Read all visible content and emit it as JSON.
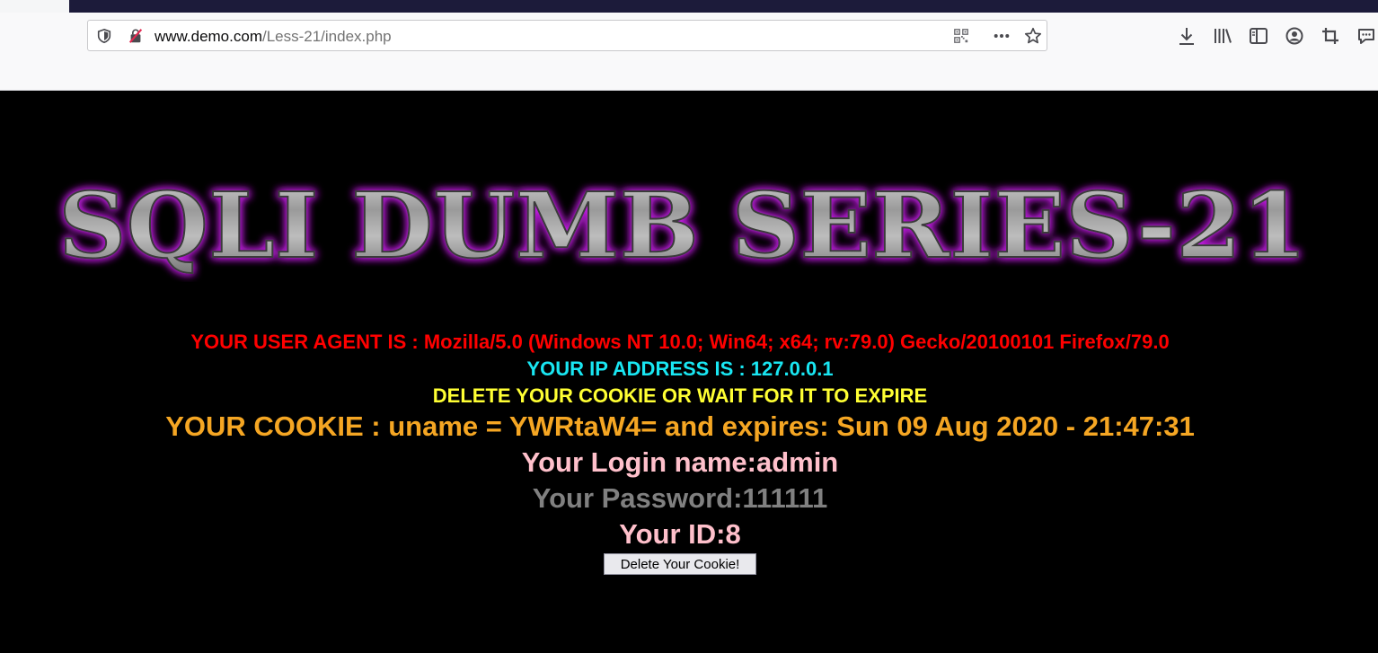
{
  "browser": {
    "url_host": "www.demo.com",
    "url_path": "/Less-21/index.php",
    "icons": [
      "shield-icon",
      "insecure-lock-icon",
      "qr-code-icon",
      "more-icon",
      "star-icon",
      "download-icon",
      "library-icon",
      "sidebar-icon",
      "account-icon",
      "screenshot-icon",
      "chat-icon"
    ]
  },
  "page": {
    "banner_text": "SQLI DUMB SERIES-21",
    "user_agent_line": "YOUR USER AGENT IS : Mozilla/5.0 (Windows NT 10.0; Win64; x64; rv:79.0) Gecko/20100101 Firefox/79.0",
    "ip_line": "YOUR IP ADDRESS IS : 127.0.0.1",
    "delete_notice": "DELETE YOUR COOKIE OR WAIT FOR IT TO EXPIRE",
    "cookie_line": "YOUR COOKIE : uname = YWRtaW4= and expires: Sun 09 Aug 2020 - 21:47:31",
    "login_line": "Your Login name:admin",
    "password_line": "Your Password:111111",
    "id_line": "Your ID:8",
    "delete_button_label": "Delete Your Cookie!"
  },
  "colors": {
    "background": "#000000",
    "user_agent": "#ff0000",
    "ip": "#19e6f2",
    "notice": "#ffff33",
    "cookie": "#f5a623",
    "login": "#ffc0cb",
    "password": "#808080",
    "banner_glow": "#c020e0"
  }
}
